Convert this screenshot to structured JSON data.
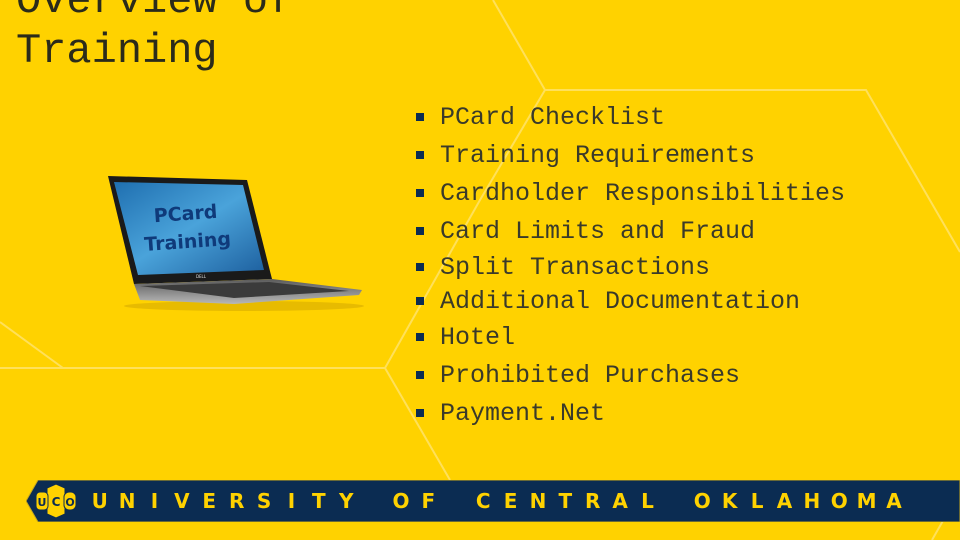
{
  "slide": {
    "title_lines": [
      "Overview of",
      "Training"
    ],
    "bullets": [
      "PCard Checklist",
      "Training Requirements",
      "Cardholder Responsibilities",
      "Card Limits and Fraud",
      "Split Transactions",
      "Additional Documentation",
      "Hotel",
      "Prohibited Purchases",
      "Payment.Net"
    ],
    "laptop_screen_text": [
      "PCard",
      "Training"
    ],
    "laptop_brand": "DELL",
    "footer": {
      "logo_text": "UCO",
      "banner_text": "UNIVERSITY OF CENTRAL OKLAHOMA"
    }
  },
  "colors": {
    "background": "#FFD200",
    "navy": "#0b2c52",
    "banner_text": "#FFD200",
    "screen_blue": "#2f86c8"
  }
}
